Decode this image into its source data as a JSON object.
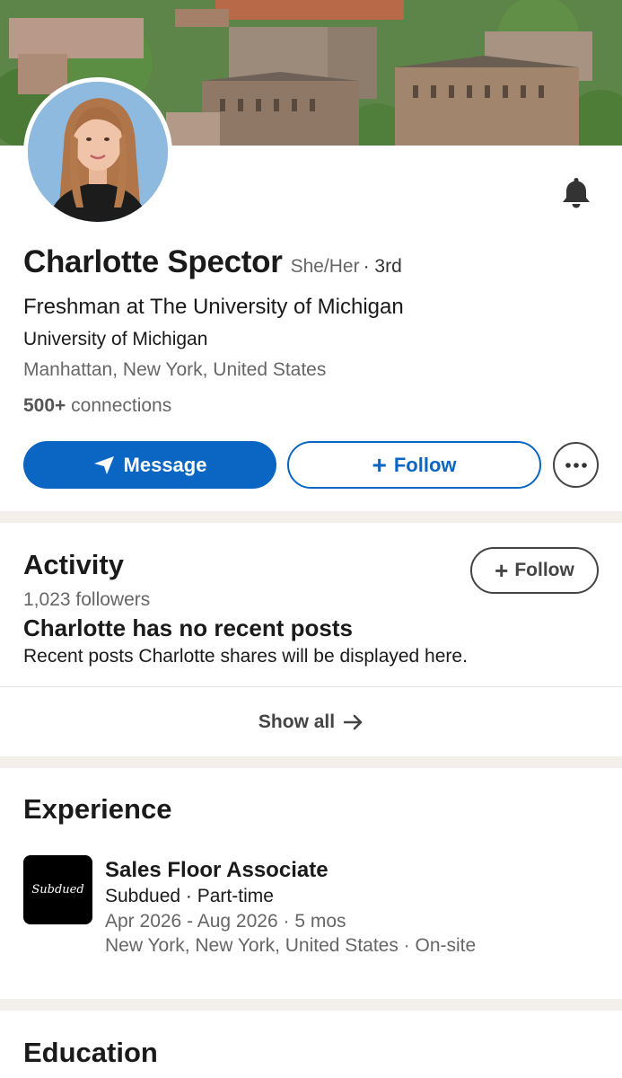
{
  "profile": {
    "name": "Charlotte Spector",
    "pronouns": "She/Her",
    "degree": "· 3rd",
    "headline": "Freshman at The University of Michigan",
    "school": "University of Michigan",
    "location": "Manhattan, New York, United States",
    "connections_count": "500+",
    "connections_label": "connections"
  },
  "actions": {
    "message_label": "Message",
    "follow_label": "Follow",
    "more_icon": "ellipsis-icon",
    "notify_icon": "bell-icon"
  },
  "activity": {
    "title": "Activity",
    "follow_label": "Follow",
    "followers": "1,023 followers",
    "empty_title": "Charlotte has no recent posts",
    "empty_desc": "Recent posts Charlotte shares will be displayed here.",
    "show_all": "Show all"
  },
  "experience": {
    "title": "Experience",
    "items": [
      {
        "logo_text": "Subdued",
        "title": "Sales Floor Associate",
        "company": "Subdued · Part-time",
        "dates": "Apr 2026 - Aug 2026 · 5 mos",
        "location": "New York, New York, United States · On-site"
      }
    ]
  },
  "education": {
    "title": "Education"
  },
  "colors": {
    "primary": "#0a66c2",
    "section_bg": "#f3f0ec",
    "text": "#1a1a1a",
    "muted": "#666666"
  }
}
